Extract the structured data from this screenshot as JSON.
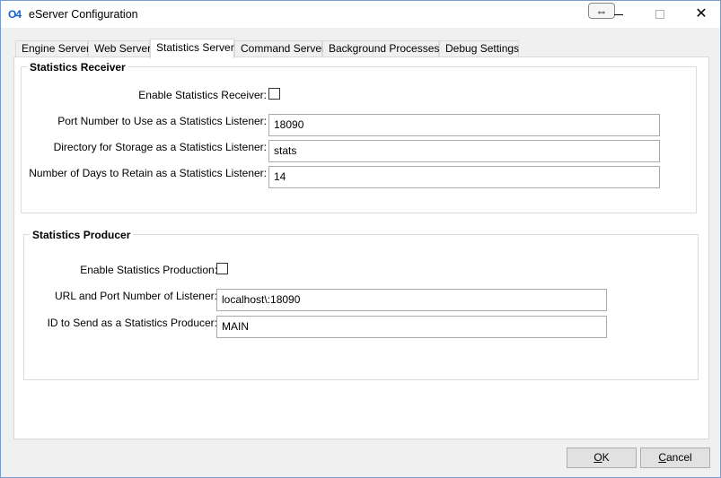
{
  "window": {
    "logo": "O4",
    "title": "eServer Configuration"
  },
  "icons": {
    "resize_glyph": "⇔",
    "close_glyph": "✕"
  },
  "tabs": [
    {
      "label": "Engine Server",
      "active": false
    },
    {
      "label": "Web Server",
      "active": false
    },
    {
      "label": "Statistics Server",
      "active": true
    },
    {
      "label": "Command Server",
      "active": false
    },
    {
      "label": "Background Processes",
      "active": false
    },
    {
      "label": "Debug Settings",
      "active": false
    }
  ],
  "receiver": {
    "title": "Statistics Receiver",
    "enable_label": "Enable Statistics Receiver:",
    "enable_checked": false,
    "port_label": "Port Number to Use as a Statistics Listener:",
    "port_value": "18090",
    "dir_label": "Directory for Storage as a Statistics Listener:",
    "dir_value": "stats",
    "days_label": "Number of Days to Retain as a Statistics Listener:",
    "days_value": "14"
  },
  "producer": {
    "title": "Statistics Producer",
    "enable_label": "Enable Statistics Production:",
    "enable_checked": false,
    "url_label": "URL and Port Number of Listener:",
    "url_value": "localhost\\:18090",
    "id_label": "ID to Send as a Statistics Producer:",
    "id_value": "MAIN"
  },
  "buttons": {
    "ok_mnemonic": "O",
    "ok_rest": "K",
    "cancel_mnemonic": "C",
    "cancel_rest": "ancel"
  }
}
